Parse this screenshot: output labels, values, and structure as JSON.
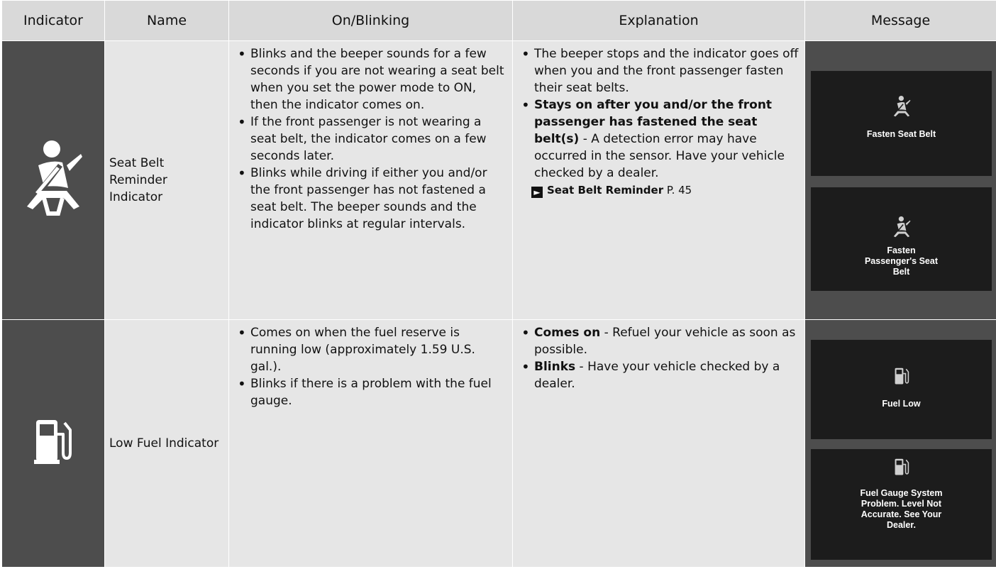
{
  "table": {
    "headers": [
      "Indicator",
      "Name",
      "On/Blinking",
      "Explanation",
      "Message"
    ]
  },
  "rows": [
    {
      "icon": "seat-belt-icon",
      "name": "Seat Belt Reminder Indicator",
      "on_blinking": [
        "Blinks and the beeper sounds for a few seconds if you are not wearing a seat belt when you set the power mode to ON, then the indicator comes on.",
        "If the front passenger is not wearing a seat belt, the indicator comes on a few seconds later.",
        "Blinks while driving if either you and/or the front passenger has not fastened a seat belt. The beeper sounds and the indicator blinks at regular intervals."
      ],
      "explanation": {
        "bullet1": "The beeper stops and the indicator goes off when you and the front passenger fasten their seat belts.",
        "bullet2_bold": "Stays on after you and/or the front passenger has fastened the seat belt(s)",
        "bullet2_rest": " - A detection error may have occurred in the sensor. Have your vehicle checked by a dealer.",
        "ref_label": "Seat Belt Reminder",
        "ref_page": " P. 45"
      },
      "messages": [
        "Fasten Seat Belt",
        "Fasten Passenger's Seat Belt"
      ]
    },
    {
      "icon": "fuel-pump-icon",
      "name": "Low Fuel Indicator",
      "on_blinking": [
        "Comes on when the fuel reserve is running low (approximately 1.59 U.S. gal.).",
        "Blinks if there is a problem with the fuel gauge."
      ],
      "explanation": {
        "bullet1_bold": "Comes on",
        "bullet1_rest": " - Refuel your vehicle as soon as possible.",
        "bullet2_bold": "Blinks",
        "bullet2_rest": " - Have your vehicle checked by a dealer."
      },
      "messages": [
        "Fuel Low",
        "Fuel Gauge System Problem. Level Not Accurate. See Your Dealer."
      ]
    }
  ],
  "colors": {
    "header_bg": "#d9d9d9",
    "cell_bg": "#e6e6e6",
    "icon_cell_bg": "#4d4d4d",
    "message_bg": "#1c1c1c"
  }
}
